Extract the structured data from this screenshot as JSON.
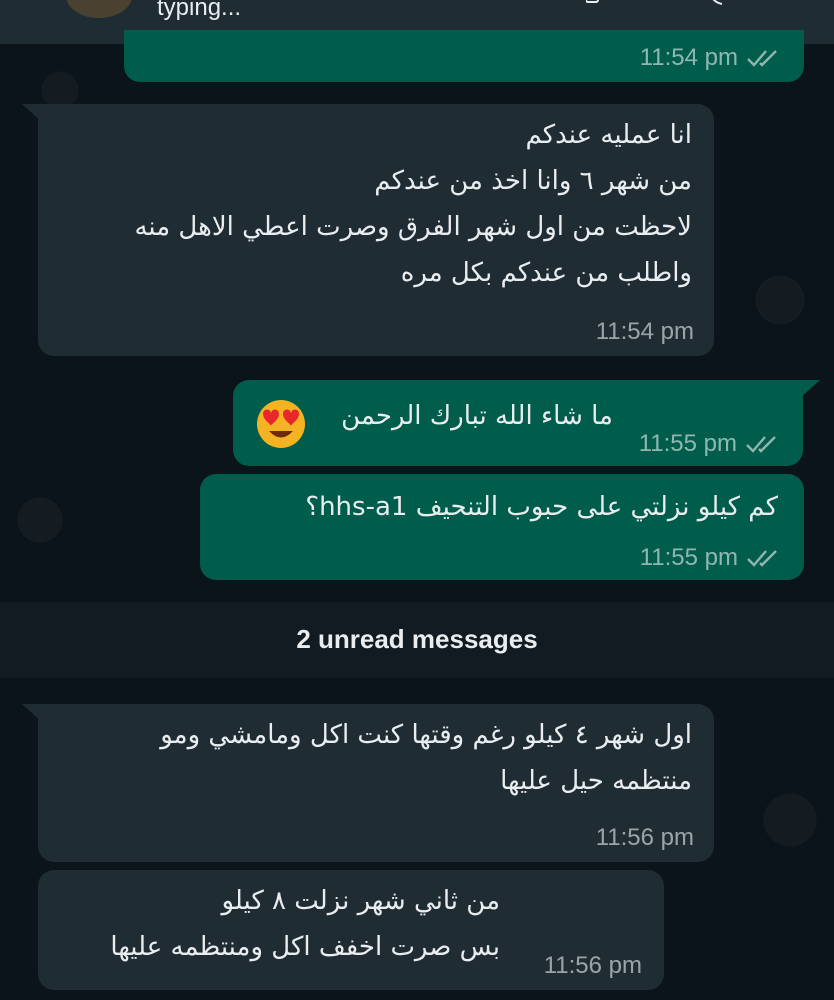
{
  "header": {
    "status": "typing...",
    "avatar_icon": "contact-avatar"
  },
  "unread_divider": "2 unread messages",
  "messages": [
    {
      "direction": "outgoing",
      "text": "",
      "time": "11:54 pm",
      "ticks": "read-double-tick"
    },
    {
      "direction": "incoming",
      "text": "انا عمليه عندكم\nمن شهر ٦ وانا اخذ من عندكم\nلاحظت من اول شهر الفرق وصرت اعطي الاهل منه\nواطلب من عندكم بكل مره",
      "time": "11:54 pm"
    },
    {
      "direction": "outgoing",
      "text": "ما شاء الله تبارك الرحمن",
      "emoji": "heart-eyes-emoji",
      "time": "11:55 pm",
      "ticks": "read-double-tick"
    },
    {
      "direction": "outgoing",
      "text": "كم كيلو نزلتي على حبوب التنحيف hhs-a1؟",
      "time": "11:55 pm",
      "ticks": "read-double-tick"
    },
    {
      "direction": "incoming",
      "text": "اول شهر ٤ كيلو رغم وقتها كنت اكل ومامشي ومو\nمنتظمه حيل عليها",
      "time": "11:56 pm"
    },
    {
      "direction": "incoming",
      "text": "من ثاني شهر نزلت ٨ كيلو\nبس صرت اخفف اكل ومنتظمه عليها",
      "time": "11:56 pm"
    }
  ],
  "colors": {
    "background": "#0b141a",
    "incoming_bubble": "#1f2c34",
    "outgoing_bubble": "#005c4b",
    "header": "#1f2c34"
  }
}
